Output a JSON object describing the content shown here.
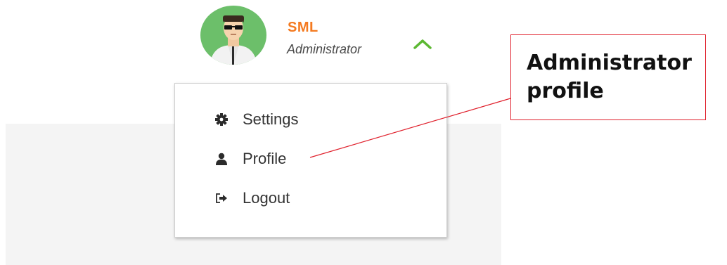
{
  "user": {
    "name": "SML",
    "role": "Administrator",
    "avatar_icon": "user-avatar-icon"
  },
  "menu": {
    "items": [
      {
        "label": "Settings",
        "icon": "gear-icon"
      },
      {
        "label": "Profile",
        "icon": "user-icon"
      },
      {
        "label": "Logout",
        "icon": "logout-icon"
      }
    ]
  },
  "callout": {
    "line1": "Administrator",
    "line2": "profile"
  },
  "colors": {
    "name": "#f47a20",
    "chevron": "#5cb832",
    "avatar_bg": "#6cbf6a",
    "callout_border": "#e0202c"
  }
}
